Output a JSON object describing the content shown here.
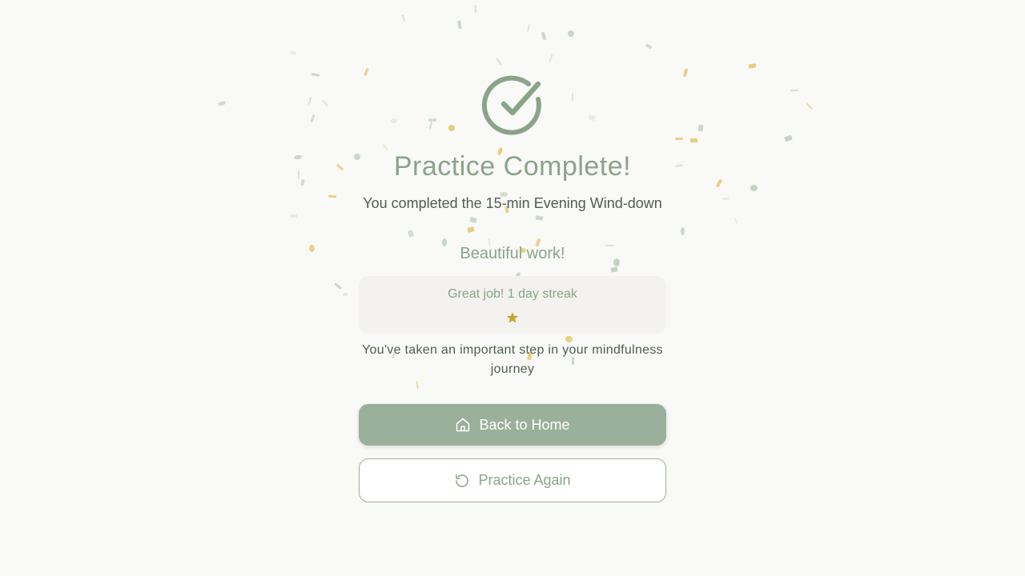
{
  "completion": {
    "title": "Practice Complete!",
    "subtitle": "You completed the 15-min Evening Wind-down",
    "icon": "check-circle-icon"
  },
  "praise": "Beautiful work!",
  "streak": {
    "text": "Great job! 1 day streak",
    "stars": 1,
    "icon": "star-icon"
  },
  "encouragement": "You've taken an important step in your mindfulness journey",
  "actions": {
    "home_label": "Back to Home",
    "home_icon": "home-icon",
    "again_label": "Practice Again",
    "again_icon": "refresh-icon"
  },
  "colors": {
    "accent": "#8aa488",
    "primary_button": "#9ab09a",
    "text": "#4f5f4d",
    "card": "#f3f2ee",
    "star": "#c9a62e",
    "confetti_gold": "#e6c66a",
    "confetti_sage": "#b8c9b6",
    "background": "#f9f9f8"
  }
}
